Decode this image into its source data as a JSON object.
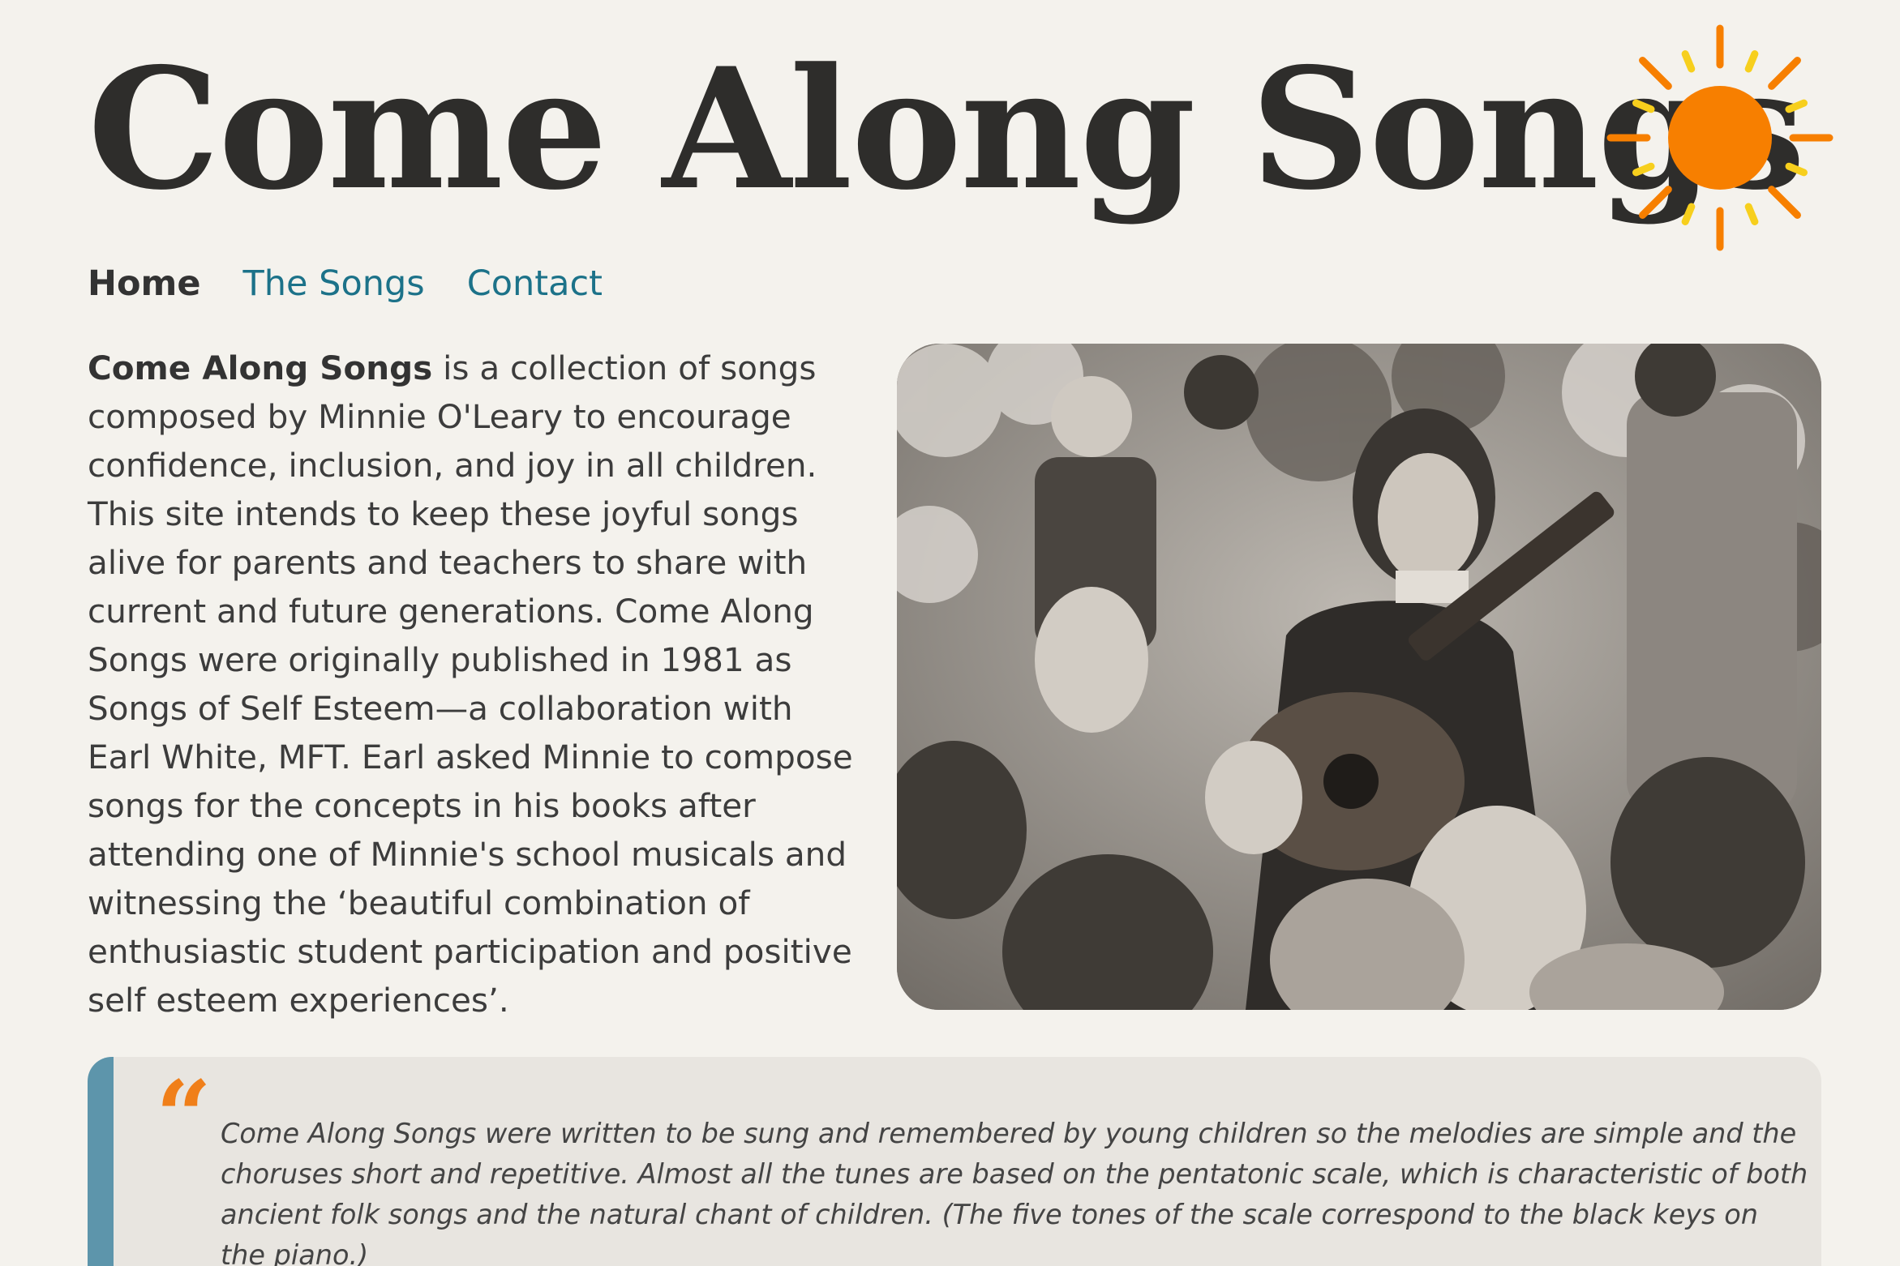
{
  "site": {
    "title": "Come Along Songs"
  },
  "nav": {
    "items": [
      {
        "label": "Home",
        "active": true
      },
      {
        "label": "The Songs",
        "active": false
      },
      {
        "label": "Contact",
        "active": false
      }
    ]
  },
  "intro": {
    "lead": "Come Along Songs",
    "body": " is a collection of songs composed by Minnie O'Leary to encourage confidence, inclusion, and joy in all children. This site intends to keep these joyful songs alive for parents and teachers to share with current and future generations. Come Along Songs were originally published in 1981 as Songs of Self Esteem—a collaboration with Earl White, MFT. Earl asked Minnie to compose songs for the concepts in his books after attending one of Minnie's school musicals and witnessing the ‘beautiful combination of enthusiastic student participation and positive self esteem experiences’."
  },
  "quote": {
    "mark": "“",
    "text": "Come Along Songs were written to be sung and remembered by young children so the melodies are simple and the choruses short and repetitive. Almost all the tunes are based on the pentatonic scale, which is characteristic of both ancient folk songs and the natural chant of children. (The five tones of the scale correspond to the black keys on the piano.)"
  },
  "colors": {
    "background": "#f4f2ed",
    "nav_link": "#1c7289",
    "sun_core": "#f77f00",
    "sun_ray_long": "#f77f00",
    "sun_ray_short": "#f7cf1d",
    "quote_border": "#5d95ab",
    "quote_mark": "#f07f1a"
  },
  "icons": {
    "logo": "sun-icon",
    "quote": "quote-mark-icon"
  }
}
